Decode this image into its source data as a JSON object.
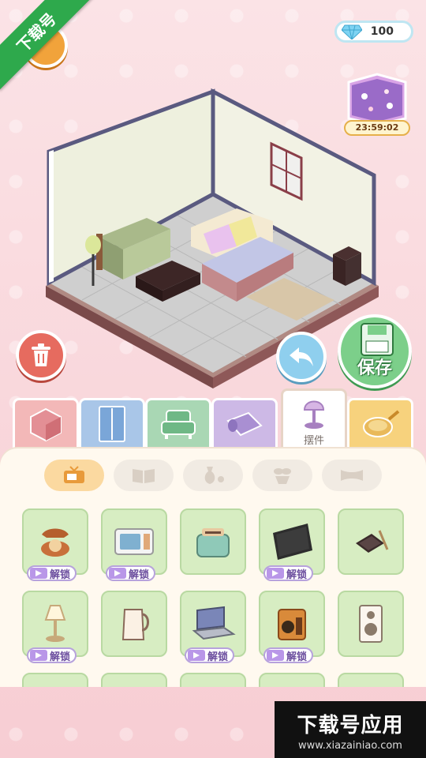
{
  "corner_banner": "下载号",
  "currency": {
    "gems": "100"
  },
  "gift": {
    "timer": "23:59:02"
  },
  "save_button": {
    "label": "保存"
  },
  "tabs": [
    {
      "id": "room",
      "icon": "room-cube-icon",
      "color": "#f3b8b8"
    },
    {
      "id": "wardrobe",
      "icon": "wardrobe-icon",
      "color": "#a9c6e8"
    },
    {
      "id": "sofa",
      "icon": "armchair-icon",
      "color": "#a9d7b4"
    },
    {
      "id": "rug",
      "icon": "rug-icon",
      "color": "#cdb9e6"
    },
    {
      "id": "decor",
      "icon": "lamp-icon",
      "label": "摆件",
      "active": true
    },
    {
      "id": "kitchen",
      "icon": "frying-pan-icon",
      "color": "#f7d27d"
    }
  ],
  "subtabs": [
    {
      "icon": "tv-icon",
      "active": true
    },
    {
      "icon": "book-icon"
    },
    {
      "icon": "vase-icon"
    },
    {
      "icon": "plant-icon"
    },
    {
      "icon": "pillow-icon"
    }
  ],
  "items": [
    {
      "icon": "telephone-icon",
      "unlock": "解锁"
    },
    {
      "icon": "microwave-icon",
      "unlock": "解锁"
    },
    {
      "icon": "toaster-icon"
    },
    {
      "icon": "television-icon",
      "unlock": "解锁"
    },
    {
      "icon": "tablet-icon"
    },
    {
      "icon": "table-lamp-icon",
      "unlock": "解锁"
    },
    {
      "icon": "kettle-icon"
    },
    {
      "icon": "laptop-icon",
      "unlock": "解锁"
    },
    {
      "icon": "radio-icon",
      "unlock": "解锁"
    },
    {
      "icon": "speaker-icon"
    }
  ],
  "watermark": {
    "title": "下载号应用",
    "url": "www.xiazainiao.com"
  }
}
